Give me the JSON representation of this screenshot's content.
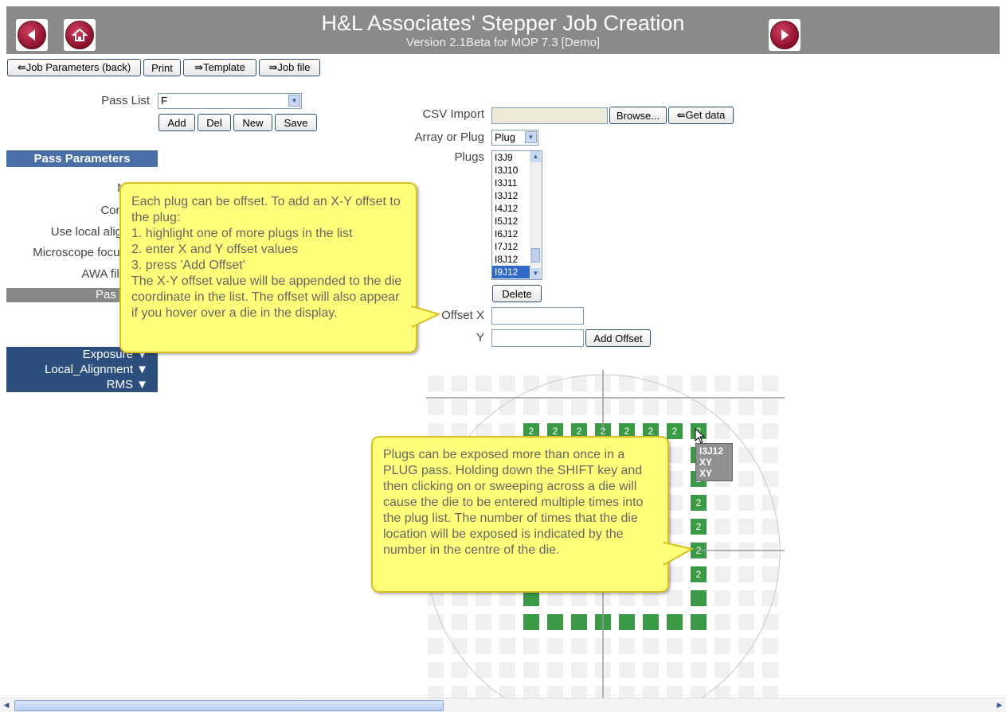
{
  "header": {
    "title": "H&L Associates' Stepper Job Creation",
    "subtitle": "Version 2.1Beta for MOP 7.3   [Demo]"
  },
  "toolbar": {
    "job_params_label": "⇚Job Parameters (back)",
    "print_label": "Print",
    "template_label": "⇛Template",
    "jobfile_label": "⇛Job file"
  },
  "pass_list": {
    "label": "Pass List",
    "selected": "F",
    "add": "Add",
    "del": "Del",
    "new": "New",
    "save": "Save"
  },
  "pass_parameters": {
    "title": "Pass Parameters",
    "row_labels": [
      "N",
      "Com",
      "Use local aligr",
      "Microscope focus",
      "AWA file"
    ],
    "gray_bar_label": "Pas"
  },
  "menus": [
    "Exposure ▼",
    "Local_Alignment ▼",
    "RMS ▼"
  ],
  "csv": {
    "label": "CSV Import",
    "browse": "Browse...",
    "get_data": "⇚Get data"
  },
  "array_or_plug": {
    "label": "Array or Plug",
    "selected": "Plug"
  },
  "plugs": {
    "label": "Plugs",
    "items": [
      "I3J9",
      "I3J10",
      "I3J11",
      "I3J12",
      "I4J12",
      "I5J12",
      "I6J12",
      "I7J12",
      "I8J12",
      "I9J12"
    ],
    "delete": "Delete"
  },
  "offset": {
    "x_label": "Offset X",
    "y_label": "Y",
    "x_value": "",
    "y_value": "",
    "add_offset": "Add Offset"
  },
  "callout_offset": "Each plug can be offset. To add an X-Y offset to the plug:\n1. highlight one of more plugs in the list\n2. enter X and Y offset values\n3. press 'Add Offset'\nThe X-Y offset value will be appended to the die coordinate in the list. The offset will also appear if you hover over a die in the display.",
  "callout_plugs": "Plugs can be exposed more than once in a PLUG pass. Holding down the SHIFT key and then clicking on or sweeping across a die  will cause the die to be entered multiple times into the plug list. The number of times that the die location will be exposed is indicated by the number in the centre of the die.",
  "tooltip": [
    "I3J12",
    "XY",
    "XY"
  ],
  "die_count_label": "2",
  "colors": {
    "header": "#8a8a8a",
    "section_bar": "#4a6ea6",
    "menu": "#2d4f7e",
    "die_green": "#3a9a45",
    "callout": "#ffff7a"
  }
}
